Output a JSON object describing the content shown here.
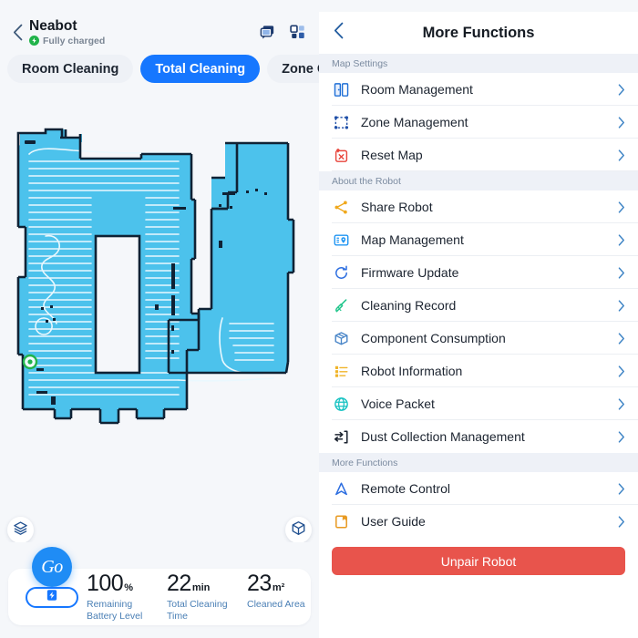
{
  "status_bar": {
    "left": "",
    "right": ""
  },
  "left_panel": {
    "back_icon": "chevron-left-icon",
    "robot_name": "Neabot",
    "robot_status": "Fully charged",
    "status_icon": "charging-bolt-icon",
    "header_icons": [
      {
        "name": "chat-bubble-icon",
        "label": "Messages"
      },
      {
        "name": "dashboard-grid-icon",
        "label": "Dashboard"
      }
    ],
    "tabs": [
      {
        "label": "Room Cleaning",
        "active": false
      },
      {
        "label": "Total Cleaning",
        "active": true
      },
      {
        "label": "Zone Cleaning",
        "active": false
      }
    ],
    "map": {
      "layers_button_icon": "map-layers-icon",
      "cube_button_icon": "map-3d-cube-icon",
      "dock_marker_icon": "charging-dock-marker",
      "floor_fill_color": "#4cc2ec",
      "wall_color": "#0f2235",
      "path_color": "#e8f7fd",
      "background_color": "#f5f7fa"
    },
    "go_button": {
      "label": "Go",
      "color": "#1f8cf5"
    },
    "battery_pill_icon": "battery-charging-icon",
    "stats": [
      {
        "value": "100",
        "unit": "%",
        "label": "Remaining Battery Level"
      },
      {
        "value": "22",
        "unit": "min",
        "label": "Total Cleaning Time"
      },
      {
        "value": "23",
        "unit": "m²",
        "label": "Cleaned Area"
      }
    ]
  },
  "right_panel": {
    "back_icon": "chevron-left-icon",
    "title": "More Functions",
    "sections": [
      {
        "header": "Map Settings",
        "items": [
          {
            "label": "Room Management",
            "icon": "room-management-icon",
            "color": "#1f6fd6"
          },
          {
            "label": "Zone Management",
            "icon": "zone-management-icon",
            "color": "#1f4fa8"
          },
          {
            "label": "Reset Map",
            "icon": "reset-map-icon",
            "color": "#e8463c"
          }
        ]
      },
      {
        "header": "About the Robot",
        "items": [
          {
            "label": "Share Robot",
            "icon": "share-icon",
            "color": "#f0a91e"
          },
          {
            "label": "Map Management",
            "icon": "map-management-icon",
            "color": "#2196f3"
          },
          {
            "label": "Firmware Update",
            "icon": "firmware-update-icon",
            "color": "#2d6ee0"
          },
          {
            "label": "Cleaning Record",
            "icon": "cleaning-record-broom-icon",
            "color": "#1ec58a"
          },
          {
            "label": "Component Consumption",
            "icon": "component-box-icon",
            "color": "#4a86c8"
          },
          {
            "label": "Robot Information",
            "icon": "robot-info-list-icon",
            "color": "#f0b429"
          },
          {
            "label": "Voice Packet",
            "icon": "globe-icon",
            "color": "#16c2c2"
          },
          {
            "label": "Dust Collection Management",
            "icon": "dust-collection-icon",
            "color": "#1c2430"
          }
        ]
      },
      {
        "header": "More Functions",
        "items": [
          {
            "label": "Remote Control",
            "icon": "remote-control-arrow-icon",
            "color": "#2d6ee0"
          },
          {
            "label": "User Guide",
            "icon": "user-guide-book-icon",
            "color": "#e89a22"
          }
        ]
      }
    ],
    "chevron_icon": "chevron-right-icon",
    "unpair_button": {
      "label": "Unpair Robot",
      "color": "#e8544c"
    }
  }
}
